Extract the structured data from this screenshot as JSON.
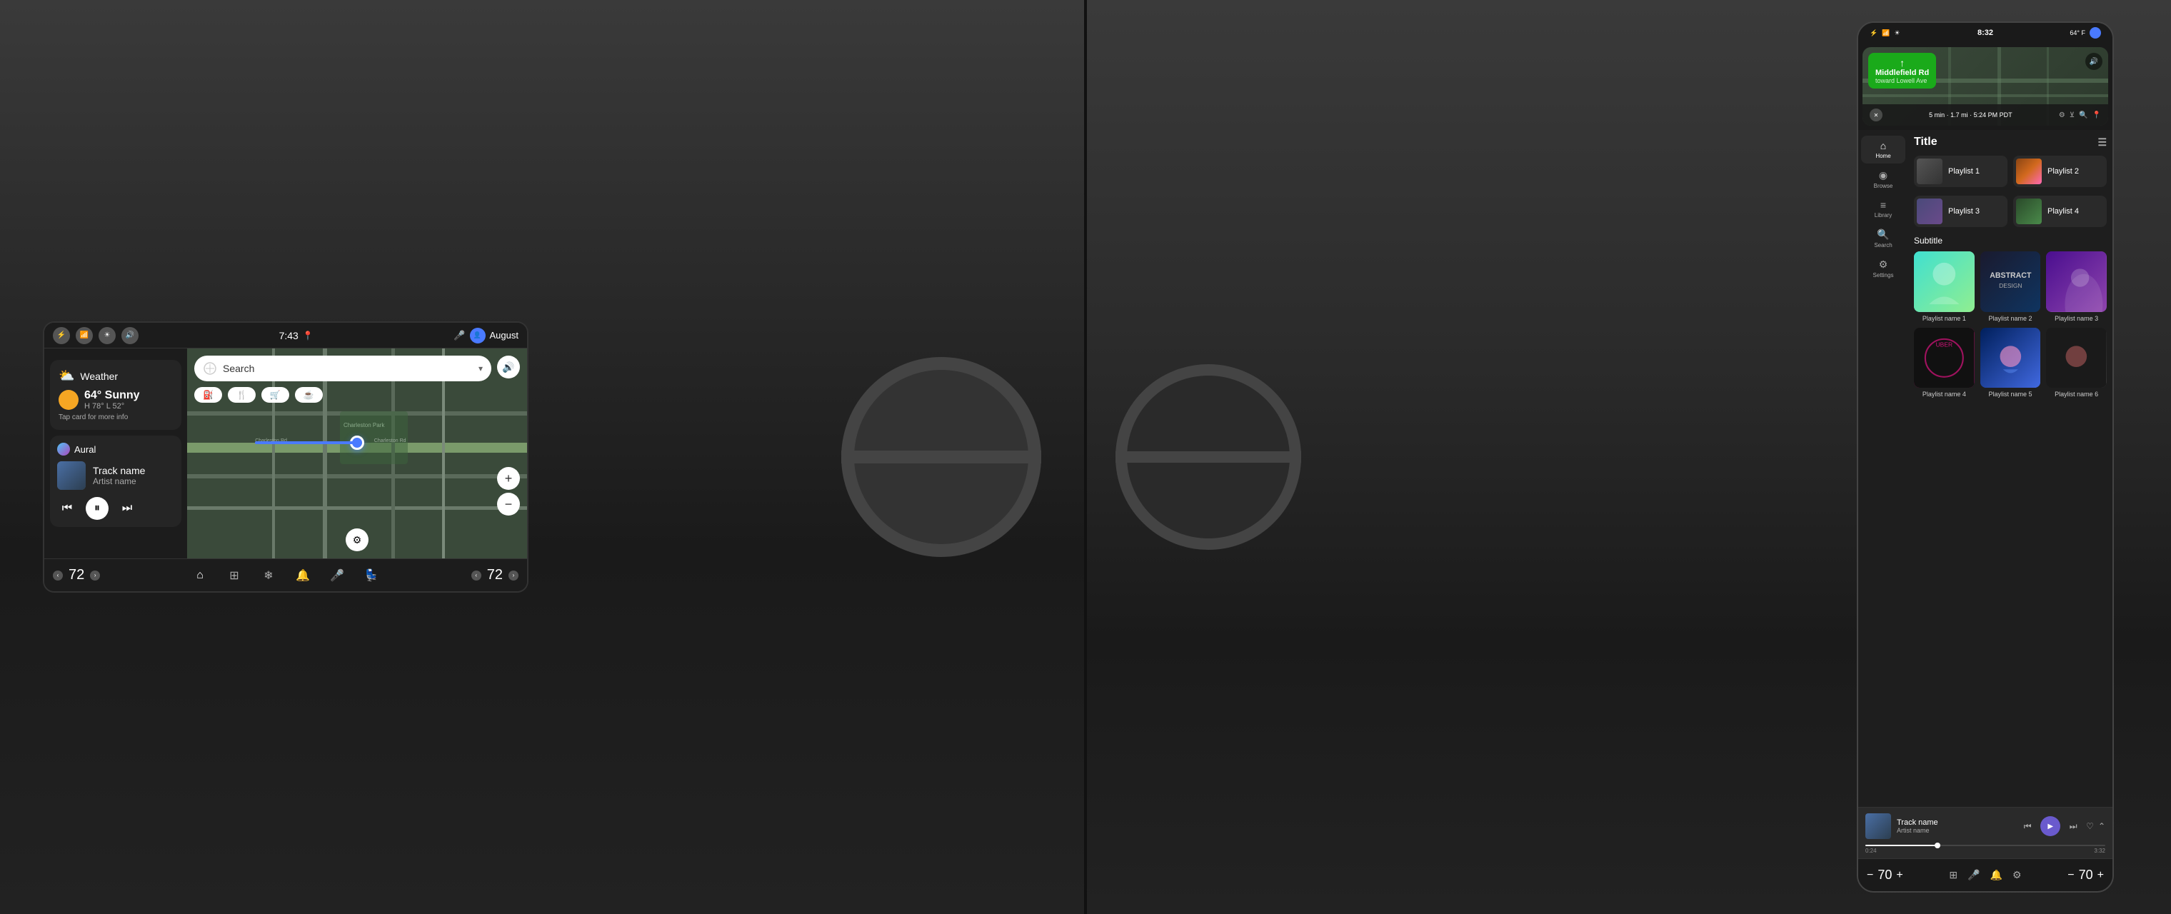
{
  "left": {
    "status_bar": {
      "time": "7:43",
      "location_pin": "📍",
      "user_name": "August",
      "mic_icon": "🎤",
      "user_icon": "👤"
    },
    "weather": {
      "title": "Weather",
      "temperature": "64°",
      "condition": "Sunny",
      "high": "H 78°",
      "low": "L 52°",
      "tap_hint": "Tap card for more info"
    },
    "music": {
      "app_name": "Aural",
      "track_name": "Track name",
      "artist_name": "Artist name",
      "play_icon": "⏸",
      "prev_icon": "⏮",
      "next_icon": "⏭"
    },
    "search": {
      "placeholder": "Search"
    },
    "poi": {
      "gas": "⛽",
      "food": "🍴",
      "shopping": "🛒",
      "coffee": "☕"
    },
    "bottom_bar": {
      "temp_left": "72",
      "temp_right": "72",
      "nav_home": "⌂",
      "nav_grid": "⊞",
      "nav_fan": "❄",
      "nav_bell": "🔔",
      "nav_mic": "🎤",
      "nav_seat": "💺"
    }
  },
  "right": {
    "status_bar": {
      "time": "8:32",
      "temp": "64° F",
      "bluetooth": "⚡",
      "signal": "📶",
      "brightness": "☀"
    },
    "nav": {
      "street": "Middlefield Rd",
      "towards": "toward Lowell Ave",
      "eta": "5 min · 1.7 mi",
      "arrival": "5:24 PM PDT"
    },
    "sidebar": {
      "items": [
        {
          "label": "Home",
          "icon": "⌂",
          "active": true
        },
        {
          "label": "Browse",
          "icon": "◉"
        },
        {
          "label": "Library",
          "icon": "≡"
        },
        {
          "label": "Search",
          "icon": "🔍"
        },
        {
          "label": "Settings",
          "icon": "⚙"
        }
      ]
    },
    "content": {
      "title": "Title",
      "queue_icon": "☰",
      "playlists_row1": [
        {
          "name": "Playlist 1",
          "thumb": "1"
        },
        {
          "name": "Playlist 2",
          "thumb": "2"
        }
      ],
      "playlists_row2": [
        {
          "name": "Playlist 3",
          "thumb": "3"
        },
        {
          "name": "Playlist 4",
          "thumb": "4"
        }
      ],
      "subtitle": "Subtitle",
      "large_playlists": [
        {
          "name": "Playlist name 1",
          "thumb": "lg1"
        },
        {
          "name": "Playlist name 2",
          "thumb": "lg2"
        },
        {
          "name": "Playlist name 3",
          "thumb": "lg3"
        },
        {
          "name": "Playlist name 4",
          "thumb": "lg4"
        },
        {
          "name": "Playlist name 5",
          "thumb": "lg5"
        },
        {
          "name": "Playlist name 6",
          "thumb": "lg6"
        }
      ]
    },
    "player": {
      "track_name": "Track name",
      "artist_name": "Artist name",
      "progress_current": "0:24",
      "progress_total": "3:32",
      "play_icon": "▶",
      "prev_icon": "⏮",
      "next_icon": "⏭"
    },
    "bottom_bar": {
      "temp_left": "70",
      "temp_right": "70",
      "grid_icon": "⊞",
      "mic_icon": "🎤",
      "bell_icon": "🔔",
      "settings_icon": "⚙"
    }
  }
}
